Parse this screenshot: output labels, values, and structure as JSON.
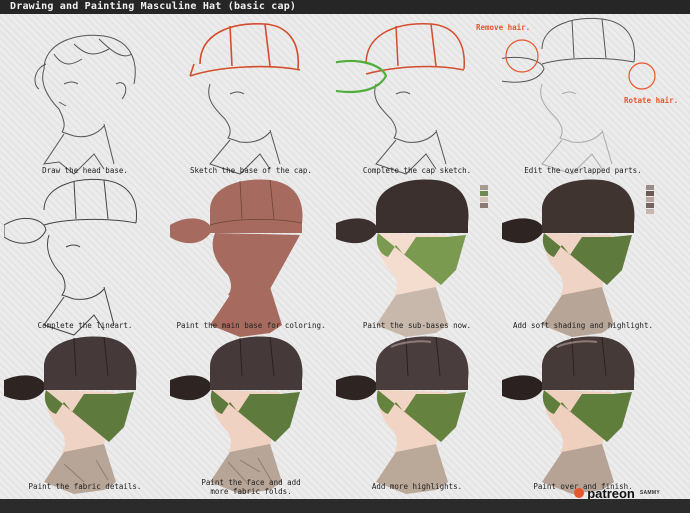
{
  "title": "Drawing and Painting Masculine Hat (basic cap)",
  "colors": {
    "title_bar": "#262626",
    "note_red": "#e8552a",
    "base_color": "#a66b5e",
    "cap_dark": "#3b302d",
    "hair_green": "#7a9a4f",
    "skin": "#f4dccf",
    "coat": "#c8b8ab"
  },
  "panels": [
    {
      "caption": "Draw the head base."
    },
    {
      "caption": "Sketch the base of the cap."
    },
    {
      "caption": "Complete the cap sketch."
    },
    {
      "caption": "Edit the overlapped parts."
    },
    {
      "caption": "Complete the lineart."
    },
    {
      "caption": "Paint the main base for coloring."
    },
    {
      "caption": "Paint the sub-bases now."
    },
    {
      "caption": "Add soft shading and highlight."
    },
    {
      "caption": "Paint the fabric details."
    },
    {
      "caption": "Paint the face and add",
      "caption2": "more fabric folds."
    },
    {
      "caption": "Add more highlights."
    },
    {
      "caption": "Paint over and finish."
    }
  ],
  "notes": {
    "remove_hair": "Remove hair.",
    "rotate_hair": "Rotate hair."
  },
  "brand": {
    "name": "patreon",
    "user": "SAMMY"
  },
  "swatches_a": [
    "#a79a92",
    "#6e8a4c",
    "#d4c3b9",
    "#8c7a72"
  ],
  "swatches_b": [
    "#9b8d86",
    "#6d5a55",
    "#b9a59c",
    "#756560",
    "#c9b5ab"
  ]
}
